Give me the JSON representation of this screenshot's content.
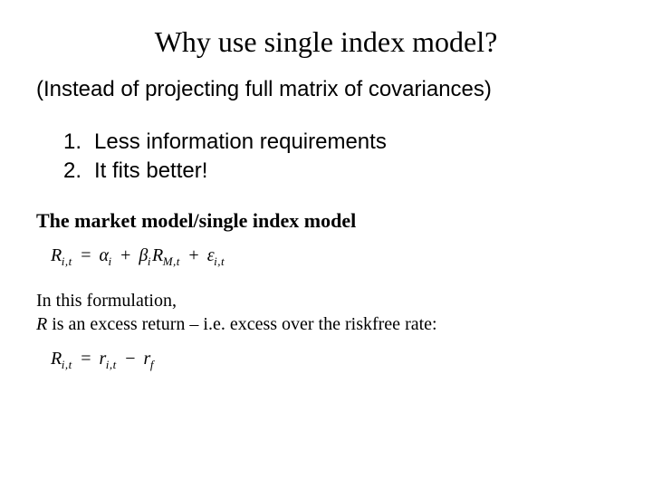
{
  "title": "Why use single index model?",
  "subtitle": "(Instead of projecting full matrix of covariances)",
  "list": {
    "item1_num": "1.",
    "item1_text": "Less information requirements",
    "item2_num": "2.",
    "item2_text": "It fits better!"
  },
  "subheading": "The market model/single index model",
  "eq1": {
    "R": "R",
    "sub_it": "i,t",
    "eq": "=",
    "alpha": "α",
    "sub_i": "i",
    "plus1": "+",
    "beta": "β",
    "sub_i2": "i",
    "Rm": "R",
    "sub_Mt": "M,t",
    "plus2": "+",
    "eps": "ε",
    "sub_it2": "i,t"
  },
  "body": {
    "line1": "In this formulation,",
    "line2a": "R",
    "line2b": " is an excess return – i.e. excess over the riskfree rate:"
  },
  "eq2": {
    "R": "R",
    "sub_it": "i,t",
    "eq": "=",
    "r1": "r",
    "sub_it2": "i,t",
    "minus": "−",
    "r2": "r",
    "sub_f": "f"
  }
}
